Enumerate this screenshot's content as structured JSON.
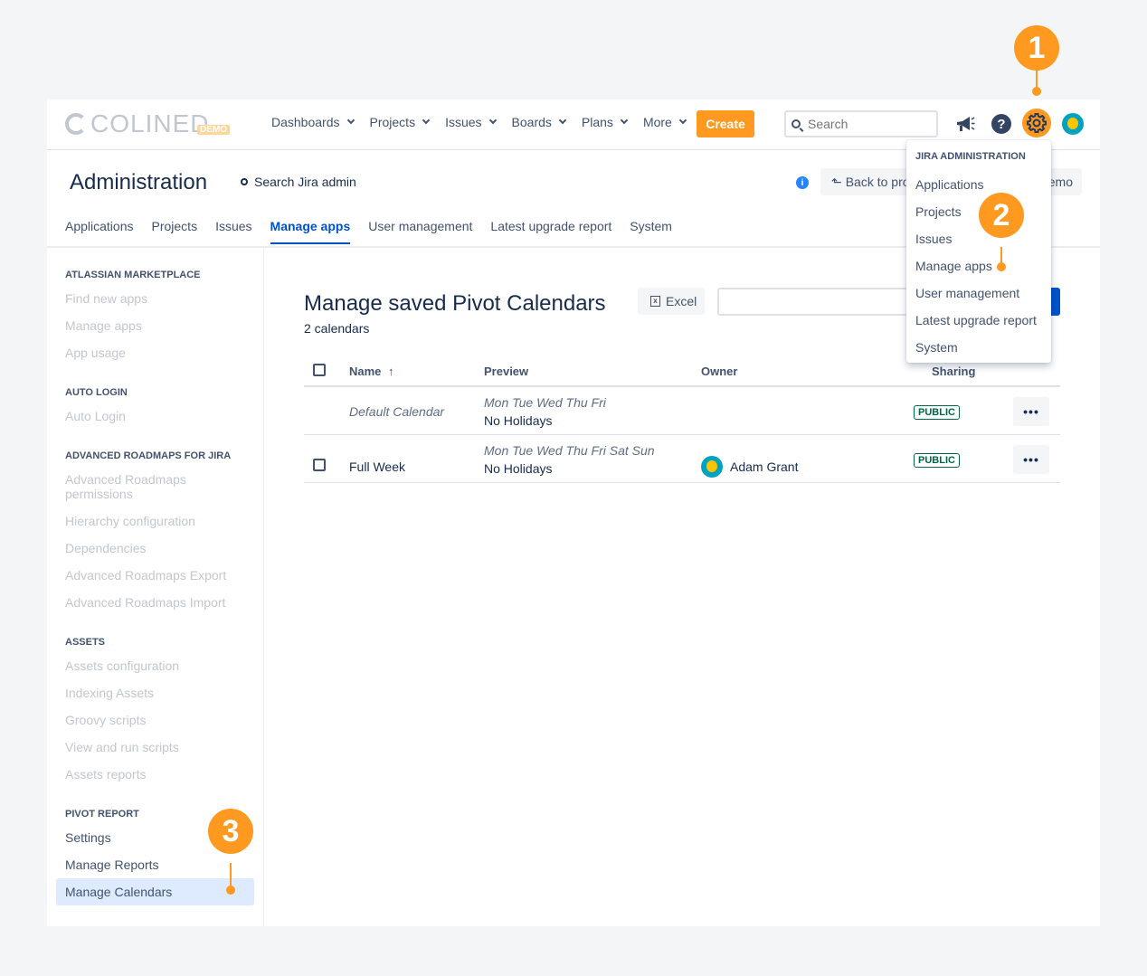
{
  "logo": {
    "text": "COLINED",
    "badge": "DEMO"
  },
  "nav": {
    "items": [
      "Dashboards",
      "Projects",
      "Issues",
      "Boards",
      "Plans",
      "More"
    ],
    "create_label": "Create",
    "search_placeholder": "Search"
  },
  "topbar_icons": [
    "megaphone-icon",
    "help-icon",
    "gear-icon",
    "avatar"
  ],
  "admin": {
    "title": "Administration",
    "search_label": "Search Jira admin",
    "back_label": "Back to pro",
    "demo_label": "emo",
    "info": "i"
  },
  "tabs": [
    "Applications",
    "Projects",
    "Issues",
    "Manage apps",
    "User management",
    "Latest upgrade report",
    "System"
  ],
  "active_tab": "Manage apps",
  "sidebar": {
    "sections": [
      {
        "heading": "ATLASSIAN MARKETPLACE",
        "items": [
          "Find new apps",
          "Manage apps",
          "App usage"
        ]
      },
      {
        "heading": "AUTO LOGIN",
        "items": [
          "Auto Login"
        ]
      },
      {
        "heading": "ADVANCED ROADMAPS FOR JIRA",
        "items": [
          "Advanced Roadmaps permissions",
          "Hierarchy configuration",
          "Dependencies",
          "Advanced Roadmaps Export",
          "Advanced Roadmaps Import"
        ]
      },
      {
        "heading": "ASSETS",
        "items": [
          "Assets configuration",
          "Indexing Assets",
          "Groovy scripts",
          "View and run scripts",
          "Assets reports"
        ]
      },
      {
        "heading": "PIVOT REPORT",
        "items": [
          "Settings",
          "Manage Reports",
          "Manage Calendars"
        ]
      }
    ]
  },
  "main": {
    "title": "Manage saved Pivot Calendars",
    "count": "2 calendars",
    "excel_label": "Excel",
    "columns": [
      "Name",
      "Preview",
      "Owner",
      "Sharing"
    ],
    "sort_arrow": "↑",
    "rows": [
      {
        "name": "Default Calendar",
        "preview_days": "Mon Tue Wed Thu Fri",
        "preview_holidays": "No Holidays",
        "owner": "",
        "sharing": "PUBLIC",
        "actions": "•••"
      },
      {
        "name": "Full Week",
        "preview_days": "Mon Tue Wed Thu Fri Sat Sun",
        "preview_holidays": "No Holidays",
        "owner": "Adam Grant",
        "sharing": "PUBLIC",
        "actions": "•••"
      }
    ]
  },
  "dropdown": {
    "heading": "JIRA ADMINISTRATION",
    "items": [
      "Applications",
      "Projects",
      "Issues",
      "Manage apps",
      "User management",
      "Latest upgrade report",
      "System"
    ]
  },
  "callouts": [
    "1",
    "2",
    "3"
  ],
  "colors": {
    "accent": "#ff991f",
    "link": "#0052cc",
    "public_badge": "#006644"
  }
}
